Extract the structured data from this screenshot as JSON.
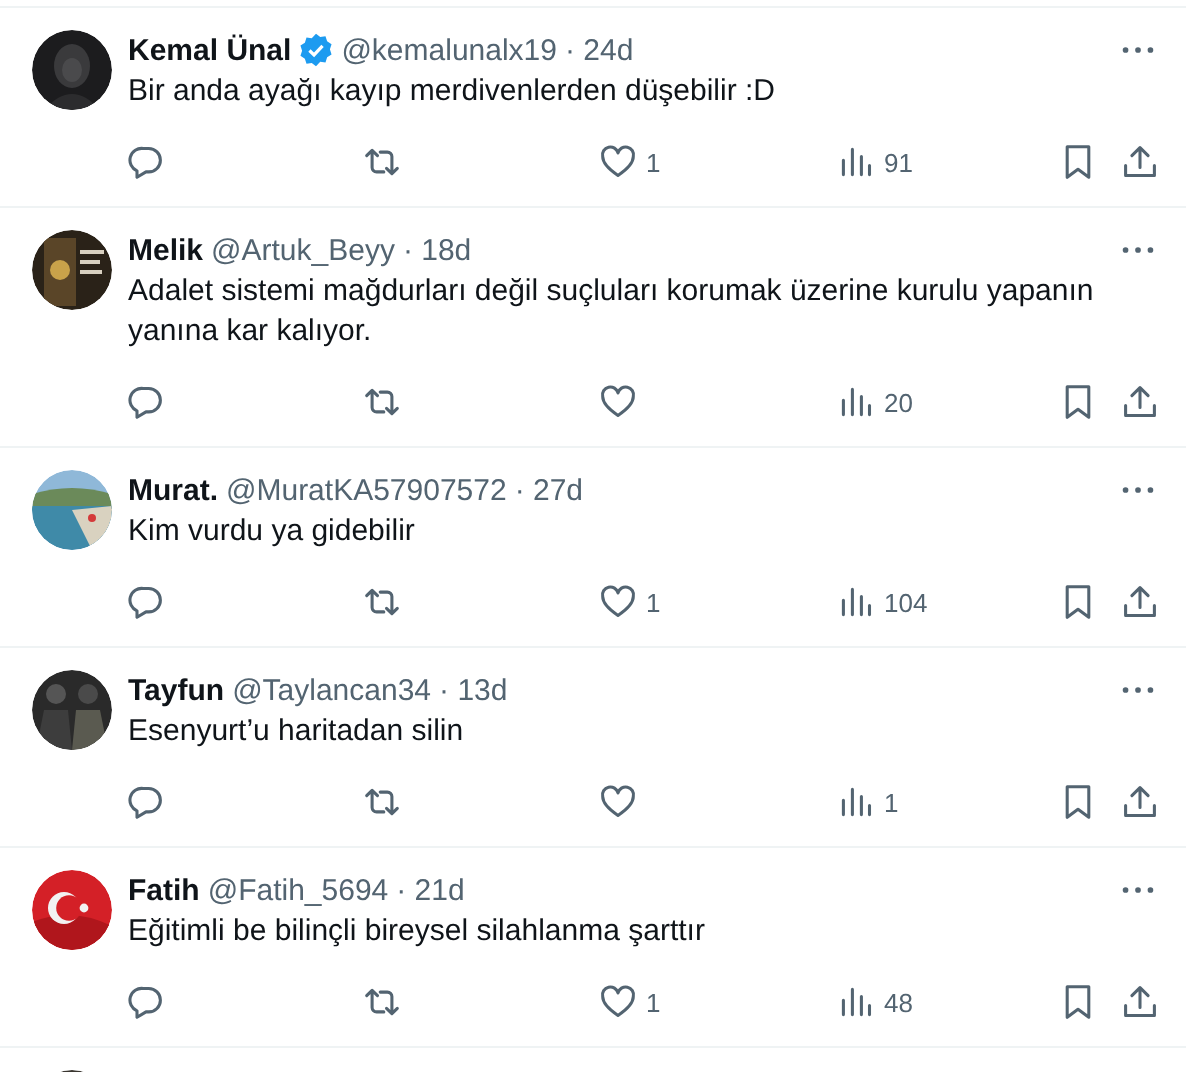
{
  "replies": [
    {
      "name": "Kemal Ünal",
      "verified": true,
      "handle": "@kemalunalx19",
      "time": "· 24d",
      "text": "Bir anda ayağı kayıp merdivenlerden düşebilir :D",
      "likes": "1",
      "views": "91"
    },
    {
      "name": "Melik",
      "verified": false,
      "handle": "@Artuk_Beyy",
      "time": "· 18d",
      "text": "Adalet sistemi mağdurları değil suçluları korumak üzerine kurulu yapanın yanına kar kalıyor.",
      "views": "20"
    },
    {
      "name": "Murat.",
      "verified": false,
      "handle": "@MuratKA57907572",
      "time": "· 27d",
      "text": "Kim vurdu ya gidebilir",
      "likes": "1",
      "views": "104"
    },
    {
      "name": "Tayfun",
      "verified": false,
      "handle": "@Taylancan34",
      "time": "· 13d",
      "text": "Esenyurt’u haritadan silin",
      "views": "1"
    },
    {
      "name": "Fatih",
      "verified": false,
      "handle": "@Fatih_5694",
      "time": "· 21d",
      "text": "Eğitimli be bilinçli bireysel silahlanma şarttır",
      "likes": "1",
      "views": "48"
    }
  ]
}
